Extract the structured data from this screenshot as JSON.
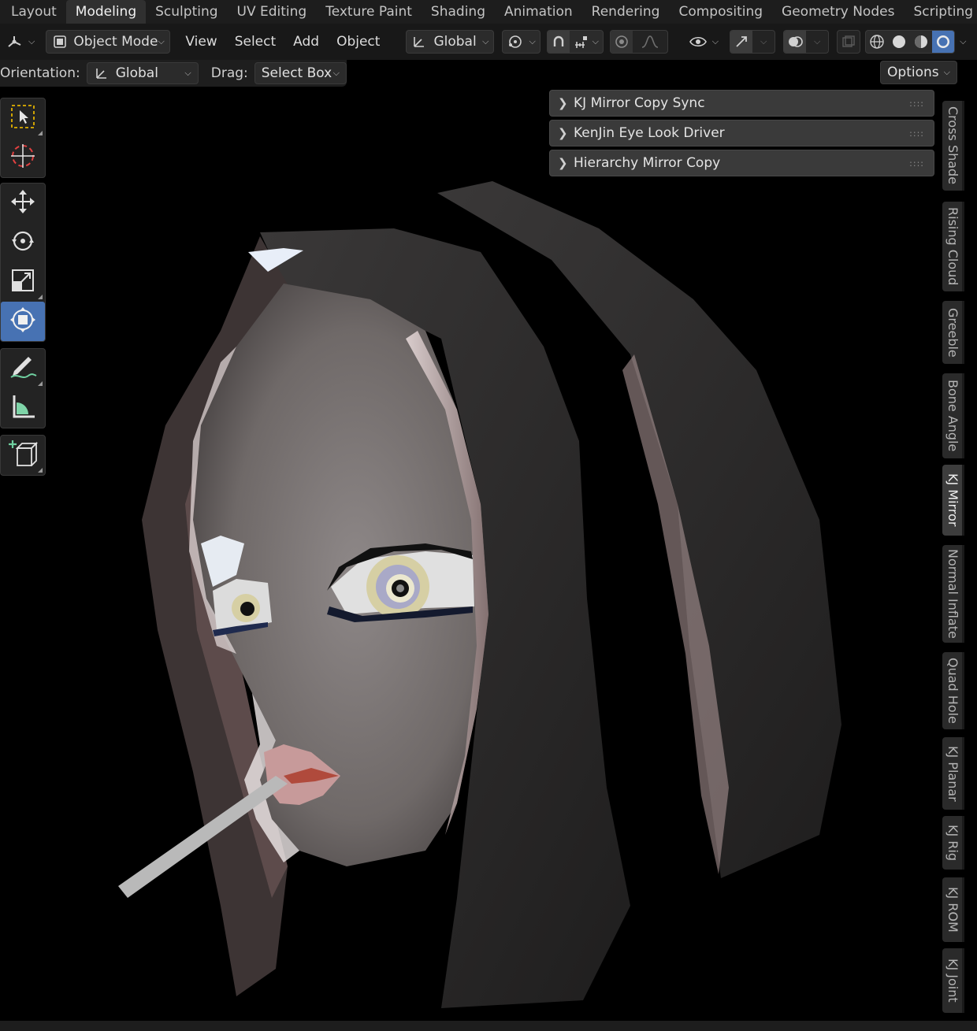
{
  "workspace_tabs": [
    {
      "label": "Layout",
      "active": false
    },
    {
      "label": "Modeling",
      "active": true
    },
    {
      "label": "Sculpting",
      "active": false
    },
    {
      "label": "UV Editing",
      "active": false
    },
    {
      "label": "Texture Paint",
      "active": false
    },
    {
      "label": "Shading",
      "active": false
    },
    {
      "label": "Animation",
      "active": false
    },
    {
      "label": "Rendering",
      "active": false
    },
    {
      "label": "Compositing",
      "active": false
    },
    {
      "label": "Geometry Nodes",
      "active": false
    },
    {
      "label": "Scripting",
      "active": false
    }
  ],
  "header": {
    "editor_type_icon": "3d-viewport-icon",
    "mode": "Object Mode",
    "menus": [
      "View",
      "Select",
      "Add",
      "Object"
    ],
    "transform_orientation": "Global",
    "pivot_icon": "pivot-point-icon",
    "snap_icon": "snap-magnet-icon",
    "snap_target_icon": "snap-increment-icon",
    "proportional_icon": "proportional-edit-icon",
    "falloff_icon": "falloff-curve-icon",
    "visibility_icon": "eye-icon",
    "gizmo_icon": "gizmo-icon",
    "overlay_icon": "overlay-icon",
    "xray_icon": "xray-icon",
    "shading_modes": [
      "wireframe",
      "solid",
      "material-preview",
      "rendered"
    ],
    "active_shading": "rendered"
  },
  "tool_settings": {
    "orientation_label": "Orientation:",
    "orientation_value": "Global",
    "drag_label": "Drag:",
    "drag_value": "Select Box",
    "options_label": "Options"
  },
  "toolbar": {
    "groups": [
      [
        "select-box-icon",
        "cursor-icon"
      ],
      [
        "move-icon",
        "rotate-icon",
        "scale-icon",
        "transform-icon"
      ],
      [
        "annotate-icon",
        "measure-icon"
      ],
      [
        "add-cube-icon"
      ]
    ],
    "active_tool": "transform-icon"
  },
  "sidebar_panels": [
    {
      "title": "KJ Mirror Copy Sync"
    },
    {
      "title": "KenJin Eye Look Driver"
    },
    {
      "title": "Hierarchy Mirror Copy"
    }
  ],
  "sidebar_tabs": [
    {
      "label": "Cross Shade",
      "active": false
    },
    {
      "label": "Rising Cloud",
      "active": false
    },
    {
      "label": "Greeble",
      "active": false
    },
    {
      "label": "Bone Angle",
      "active": false
    },
    {
      "label": "KJ Mirror",
      "active": true
    },
    {
      "label": "Normal Inflate",
      "active": false
    },
    {
      "label": "Quad Hole",
      "active": false
    },
    {
      "label": "KJ Planar",
      "active": false
    },
    {
      "label": "KJ Rig",
      "active": false
    },
    {
      "label": "KJ ROM",
      "active": false
    },
    {
      "label": "KJ Joint",
      "active": false
    }
  ],
  "colors": {
    "accent": "#4772b3",
    "viewport_bg": "#000000",
    "header_bg": "#181818",
    "panel_bg": "#3a3a3a"
  }
}
